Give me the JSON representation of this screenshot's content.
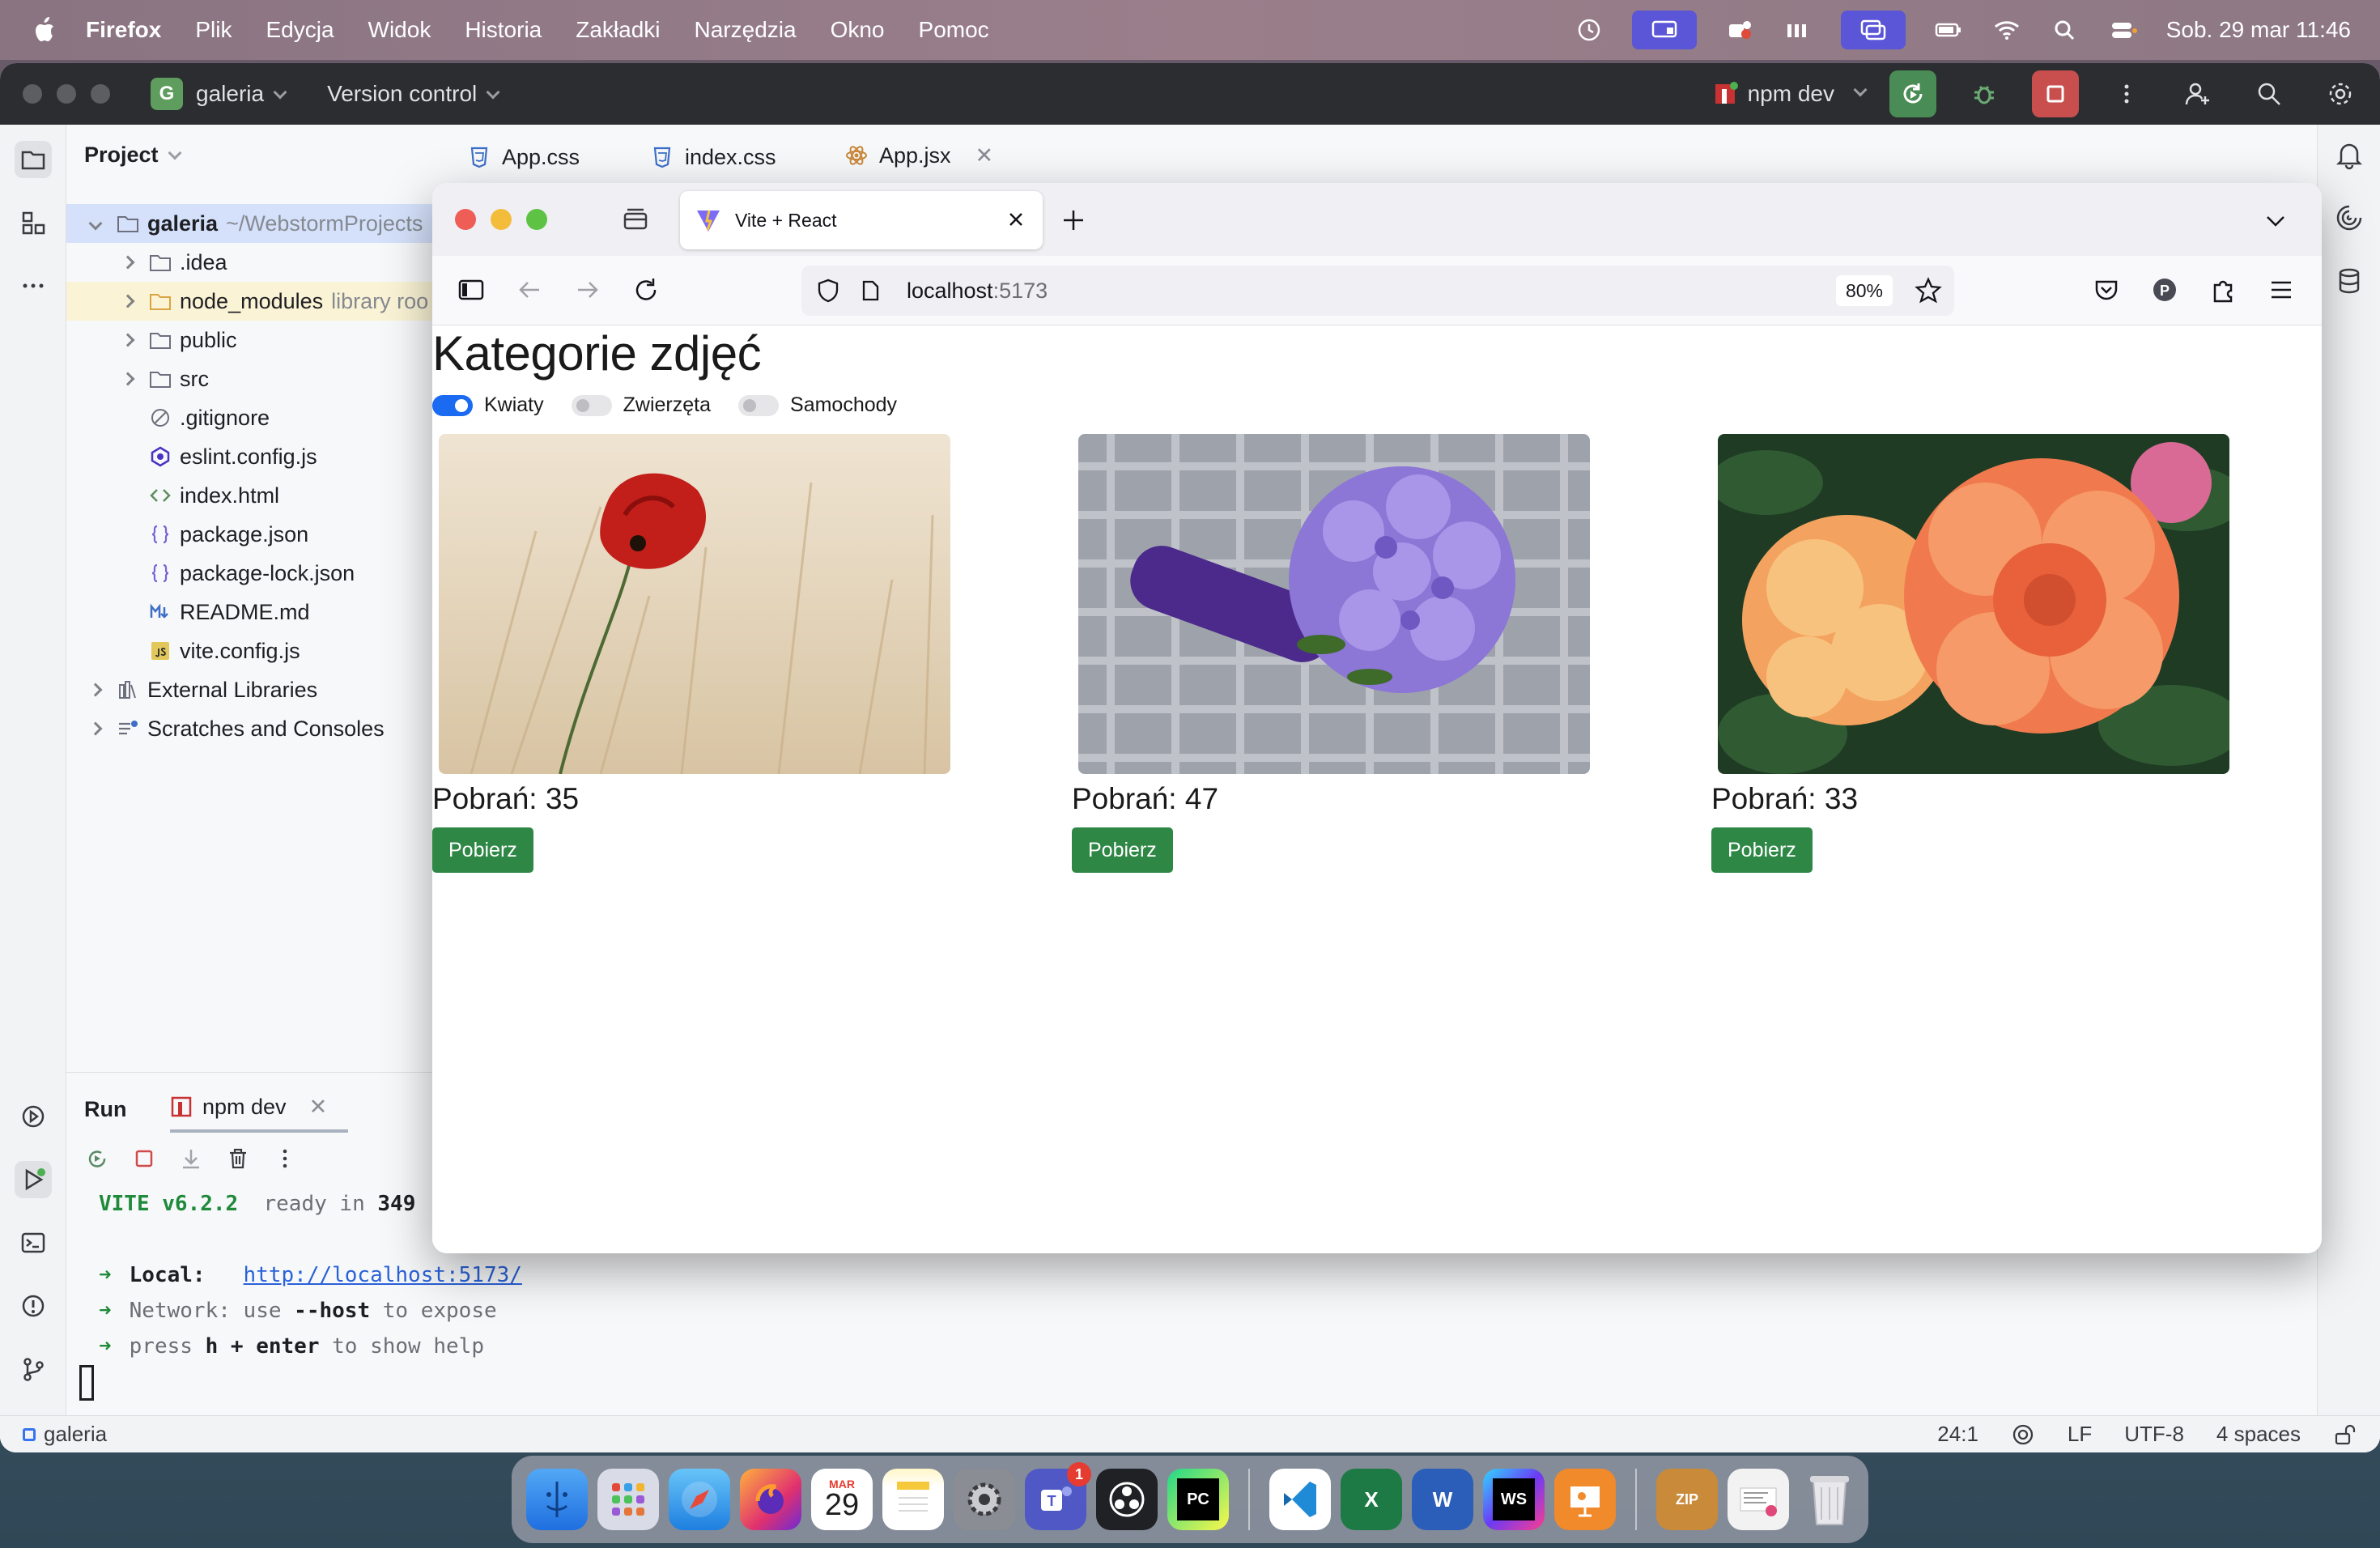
{
  "menubar": {
    "app_name": "Firefox",
    "items": [
      "Plik",
      "Edycja",
      "Widok",
      "Historia",
      "Zakładki",
      "Narzędzia",
      "Okno",
      "Pomoc"
    ],
    "clock": "Sob. 29 mar  11:46"
  },
  "ide": {
    "project_badge": "G",
    "project_name": "galeria",
    "version_control": "Version control",
    "run_config": "npm dev",
    "project_header": "Project",
    "tree": {
      "root_name": "galeria",
      "root_path": "~/WebstormProjects",
      "idea": ".idea",
      "node_modules": "node_modules",
      "node_modules_note": "library roo",
      "public": "public",
      "src": "src",
      "gitignore": ".gitignore",
      "eslint": "eslint.config.js",
      "index_html": "index.html",
      "package_json": "package.json",
      "package_lock": "package-lock.json",
      "readme": "README.md",
      "vite_config": "vite.config.js",
      "external": "External Libraries",
      "scratches": "Scratches and Consoles"
    },
    "tabs": [
      "App.css",
      "index.css",
      "App.jsx"
    ],
    "run": {
      "title": "Run",
      "tab": "npm dev",
      "vite": "VITE v6.2.2",
      "ready": "ready in",
      "ready_ms": "349",
      "local_label": "Local:",
      "local_url": "http://localhost:5173/",
      "network_label": "Network:",
      "network_use": "use",
      "network_flag": "--host",
      "network_rest": "to expose",
      "press": "press",
      "press_keys": "h + enter",
      "press_rest": "to show help"
    },
    "status": {
      "project": "galeria",
      "position": "24:1",
      "line_sep": "LF",
      "encoding": "UTF-8",
      "indent": "4 spaces"
    }
  },
  "browser": {
    "tab_title": "Vite + React",
    "url_host": "localhost",
    "url_port": ":5173",
    "zoom": "80%"
  },
  "page": {
    "title": "Kategorie zdjęć",
    "filters": [
      {
        "label": "Kwiaty",
        "on": true
      },
      {
        "label": "Zwierzęta",
        "on": false
      },
      {
        "label": "Samochody",
        "on": false
      }
    ],
    "cards": [
      {
        "count": "Pobrań: 35",
        "button": "Pobierz"
      },
      {
        "count": "Pobrań: 47",
        "button": "Pobierz"
      },
      {
        "count": "Pobrań: 33",
        "button": "Pobierz"
      }
    ],
    "button_color": "#2e8745"
  },
  "dock": {
    "calendar_month": "MAR",
    "calendar_day": "29",
    "teams_badge": "1",
    "pycharm": "PC",
    "webstorm": "WS",
    "word": "W",
    "excel": "X",
    "zip": "ZIP"
  }
}
